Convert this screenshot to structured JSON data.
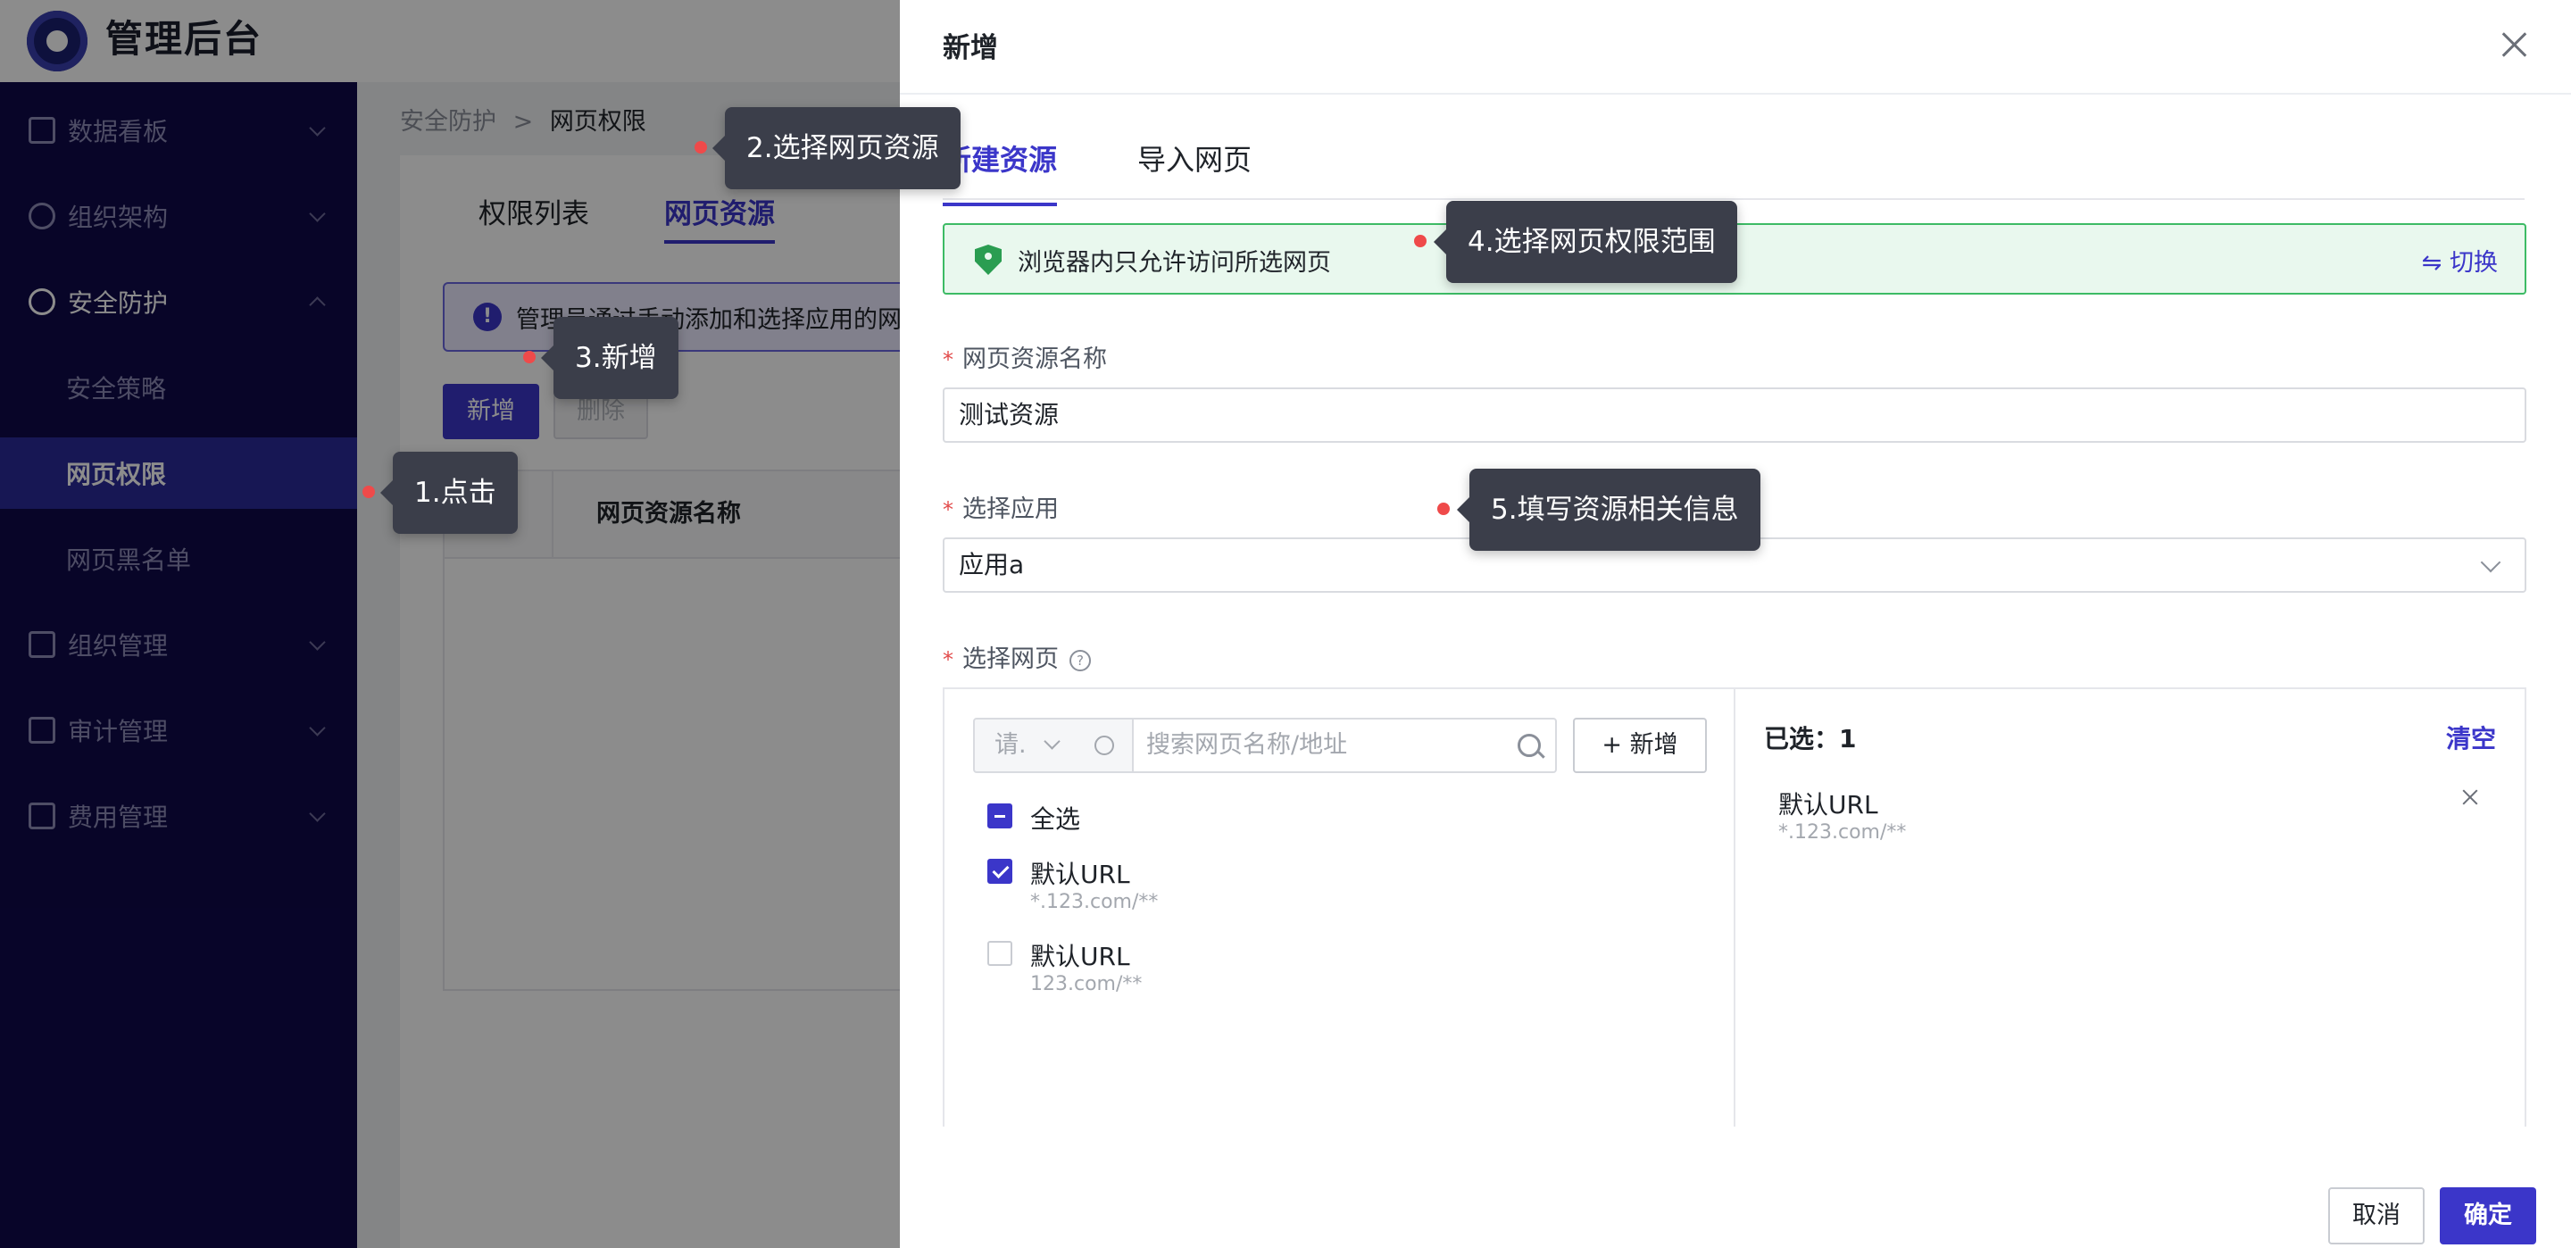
{
  "app": {
    "title": "管理后台"
  },
  "sidebar": {
    "items": [
      {
        "label": "数据看板",
        "icon": "chart-icon"
      },
      {
        "label": "组织架构",
        "icon": "org-icon"
      },
      {
        "label": "安全防护",
        "icon": "shield-icon",
        "expanded": true
      },
      {
        "label": "安全策略",
        "sub": true
      },
      {
        "label": "网页权限",
        "sub": true,
        "active": true
      },
      {
        "label": "网页黑名单",
        "sub": true
      },
      {
        "label": "组织管理",
        "icon": "layers-icon"
      },
      {
        "label": "审计管理",
        "icon": "list-icon"
      },
      {
        "label": "费用管理",
        "icon": "bill-icon"
      }
    ]
  },
  "page": {
    "breadcrumb": {
      "parent": "安全防护",
      "sep": ">",
      "current": "网页权限"
    },
    "tabs": [
      "权限列表",
      "网页资源"
    ],
    "notice": "管理员通过手动添加和选择应用的网",
    "buttons": {
      "add": "新增",
      "delete": "删除"
    },
    "table": {
      "column_name": "网页资源名称"
    }
  },
  "drawer": {
    "title": "新增",
    "tabs": [
      "新建资源",
      "导入网页"
    ],
    "scope": {
      "text": "浏览器内只允许访问所选网页",
      "switch_label": "⇋ 切换"
    },
    "fields": {
      "resource_name": {
        "label": "网页资源名称",
        "value": "测试资源"
      },
      "app": {
        "label": "选择应用",
        "value": "应用a"
      },
      "pages": {
        "label": "选择网页"
      }
    },
    "transfer": {
      "type_placeholder": "请.",
      "search_placeholder": "搜索网页名称/地址",
      "add_label": "+ 新增",
      "select_all": "全选",
      "options": [
        {
          "name": "默认URL",
          "url": "*.123.com/**",
          "checked": true
        },
        {
          "name": "默认URL",
          "url": "123.com/**",
          "checked": false
        }
      ],
      "selected_count_label": "已选：1",
      "clear_label": "清空",
      "selected": [
        {
          "name": "默认URL",
          "url": "*.123.com/**"
        }
      ]
    },
    "footer": {
      "cancel": "取消",
      "ok": "确定"
    }
  },
  "guides": [
    {
      "step": "1.点击"
    },
    {
      "step": "2.选择网页资源"
    },
    {
      "step": "3.新增"
    },
    {
      "step": "4.选择网页权限范围"
    },
    {
      "step": "5.填写资源相关信息"
    }
  ]
}
